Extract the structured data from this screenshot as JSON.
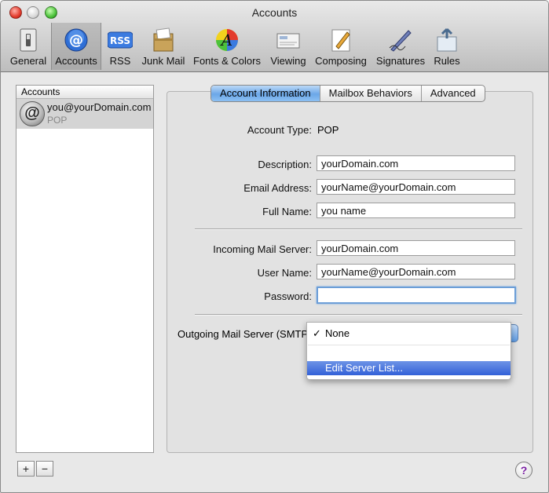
{
  "window": {
    "title": "Accounts"
  },
  "toolbar": {
    "items": [
      {
        "label": "General"
      },
      {
        "label": "Accounts"
      },
      {
        "label": "RSS"
      },
      {
        "label": "Junk Mail"
      },
      {
        "label": "Fonts & Colors"
      },
      {
        "label": "Viewing"
      },
      {
        "label": "Composing"
      },
      {
        "label": "Signatures"
      },
      {
        "label": "Rules"
      }
    ],
    "selected": "Accounts"
  },
  "sidebar": {
    "header": "Accounts",
    "accounts": [
      {
        "name": "you@yourDomain.com",
        "type": "POP",
        "icon": "@"
      }
    ],
    "add_label": "+",
    "remove_label": "−"
  },
  "tabs": [
    {
      "label": "Account Information"
    },
    {
      "label": "Mailbox Behaviors"
    },
    {
      "label": "Advanced"
    }
  ],
  "form": {
    "account_type_label": "Account Type:",
    "account_type_value": "POP",
    "description_label": "Description:",
    "description_value": "yourDomain.com",
    "email_label": "Email Address:",
    "email_value": "yourName@yourDomain.com",
    "fullname_label": "Full Name:",
    "fullname_value": "you name",
    "incoming_label": "Incoming Mail Server:",
    "incoming_value": "yourDomain.com",
    "username_label": "User Name:",
    "username_value": "yourName@yourDomain.com",
    "password_label": "Password:",
    "password_value": "",
    "smtp_label": "Outgoing Mail Server (SMTP):"
  },
  "smtp_menu": {
    "check": "✓",
    "selected": "None",
    "edit_item": "Edit Server List..."
  },
  "help_label": "?"
}
